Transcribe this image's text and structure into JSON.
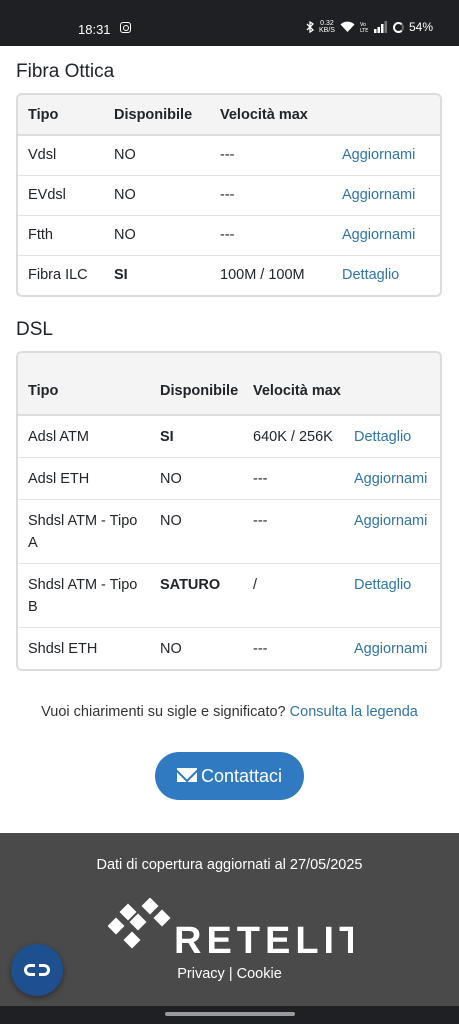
{
  "status_bar": {
    "time": "18:31",
    "net_speed_top": "0.32",
    "net_speed_bottom": "KB/S",
    "battery": "54%",
    "icons": [
      "instagram-icon",
      "bluetooth-icon",
      "wifi-icon",
      "volte-icon",
      "signal-icon",
      "battery-icon"
    ]
  },
  "fibra": {
    "title": "Fibra Ottica",
    "headers": [
      "Tipo",
      "Disponibile",
      "Velocità max",
      ""
    ],
    "rows": [
      {
        "tipo": "Vdsl",
        "disponibile": "NO",
        "velocita": "---",
        "azione": "Aggiornami"
      },
      {
        "tipo": "EVdsl",
        "disponibile": "NO",
        "velocita": "---",
        "azione": "Aggiornami"
      },
      {
        "tipo": "Ftth",
        "disponibile": "NO",
        "velocita": "---",
        "azione": "Aggiornami"
      },
      {
        "tipo": "Fibra ILC",
        "disponibile": "SI",
        "velocita": "100M / 100M",
        "azione": "Dettaglio"
      }
    ]
  },
  "dsl": {
    "title": "DSL",
    "headers": [
      "Tipo",
      "Disponibile",
      "Velocità max",
      ""
    ],
    "rows": [
      {
        "tipo": "Adsl ATM",
        "disponibile": "SI",
        "velocita": "640K / 256K",
        "azione": "Dettaglio"
      },
      {
        "tipo": "Adsl ETH",
        "disponibile": "NO",
        "velocita": "---",
        "azione": "Aggiornami"
      },
      {
        "tipo": "Shdsl ATM - Tipo A",
        "disponibile": "NO",
        "velocita": "---",
        "azione": "Aggiornami"
      },
      {
        "tipo": "Shdsl ATM - Tipo B",
        "disponibile": "SATURO",
        "velocita": "/",
        "azione": "Dettaglio"
      },
      {
        "tipo": "Shdsl ETH",
        "disponibile": "NO",
        "velocita": "---",
        "azione": "Aggiornami"
      }
    ]
  },
  "legend": {
    "question": "Vuoi chiarimenti su sigle e significato?",
    "link": "Consulta la legenda"
  },
  "contact": {
    "label": "Contattaci",
    "icon": "envelope-icon"
  },
  "footer": {
    "updated": "Dati di copertura aggiornati al 27/05/2025",
    "logo_text": "RETELIT",
    "privacy": "Privacy",
    "separator": "|",
    "cookie": "Cookie"
  },
  "colors": {
    "link": "#2f75a8",
    "button": "#2f7ac1",
    "footer_bg": "#4a4a4a",
    "fab_bg": "#1e4f8f",
    "status_bar": "#1f2023"
  }
}
